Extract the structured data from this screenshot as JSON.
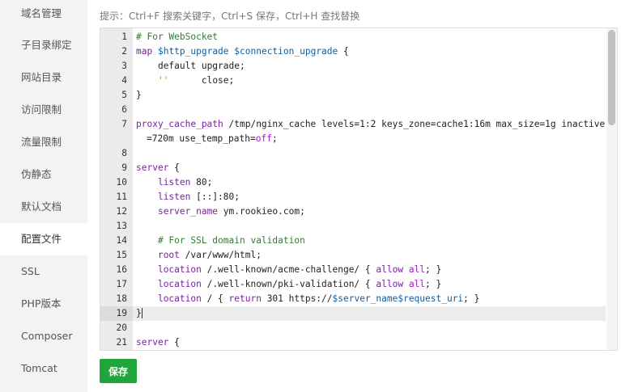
{
  "sidebar": {
    "items": [
      {
        "label": "域名管理"
      },
      {
        "label": "子目录绑定"
      },
      {
        "label": "网站目录"
      },
      {
        "label": "访问限制"
      },
      {
        "label": "流量限制"
      },
      {
        "label": "伪静态"
      },
      {
        "label": "默认文档"
      },
      {
        "label": "配置文件",
        "active": true
      },
      {
        "label": "SSL"
      },
      {
        "label": "PHP版本"
      },
      {
        "label": "Composer"
      },
      {
        "label": "Tomcat"
      }
    ]
  },
  "hint": "提示：Ctrl+F 搜索关键字，Ctrl+S 保存，Ctrl+H 查找替换",
  "editor": {
    "active_line": 19,
    "lines": [
      {
        "n": "1",
        "tokens": [
          [
            "c-comment",
            "# For WebSocket"
          ]
        ]
      },
      {
        "n": "2",
        "tokens": [
          [
            "c-kw",
            "map"
          ],
          [
            "",
            " "
          ],
          [
            "c-var",
            "$http_upgrade"
          ],
          [
            "",
            " "
          ],
          [
            "c-var",
            "$connection_upgrade"
          ],
          [
            "",
            " {"
          ]
        ]
      },
      {
        "n": "3",
        "tokens": [
          [
            "",
            "    default upgrade;"
          ]
        ]
      },
      {
        "n": "4",
        "tokens": [
          [
            "",
            "    "
          ],
          [
            "c-str",
            "''"
          ],
          [
            "",
            "      close;"
          ]
        ]
      },
      {
        "n": "5",
        "tokens": [
          [
            "",
            "}"
          ]
        ]
      },
      {
        "n": "6",
        "tokens": []
      },
      {
        "n": "7",
        "tokens": [
          [
            "c-kw",
            "proxy_cache_path"
          ],
          [
            "",
            " /tmp/nginx_cache levels=1:2 keys_zone=cache1:16m max_size=1g inactive"
          ]
        ],
        "cont": [
          [
            "",
            "=720m use_temp_path="
          ],
          [
            "c-bool",
            "off"
          ],
          [
            "",
            ";"
          ]
        ]
      },
      {
        "n": "8",
        "tokens": []
      },
      {
        "n": "9",
        "tokens": [
          [
            "c-kw",
            "server"
          ],
          [
            "",
            " {"
          ]
        ]
      },
      {
        "n": "10",
        "tokens": [
          [
            "",
            "    "
          ],
          [
            "c-kw",
            "listen"
          ],
          [
            "",
            " 80;"
          ]
        ]
      },
      {
        "n": "11",
        "tokens": [
          [
            "",
            "    "
          ],
          [
            "c-kw",
            "listen"
          ],
          [
            "",
            " [::]:80;"
          ]
        ]
      },
      {
        "n": "12",
        "tokens": [
          [
            "",
            "    "
          ],
          [
            "c-kw",
            "server_name"
          ],
          [
            "",
            " ym.rookieo.com;"
          ]
        ]
      },
      {
        "n": "13",
        "tokens": []
      },
      {
        "n": "14",
        "tokens": [
          [
            "",
            "    "
          ],
          [
            "c-comment",
            "# For SSL domain validation"
          ]
        ]
      },
      {
        "n": "15",
        "tokens": [
          [
            "",
            "    "
          ],
          [
            "c-kw",
            "root"
          ],
          [
            "",
            " /var/www/html;"
          ]
        ]
      },
      {
        "n": "16",
        "tokens": [
          [
            "",
            "    "
          ],
          [
            "c-kw",
            "location"
          ],
          [
            "",
            " /.well-known/acme-challenge/ { "
          ],
          [
            "c-kw",
            "allow"
          ],
          [
            "",
            " "
          ],
          [
            "c-bool",
            "all"
          ],
          [
            "",
            "; }"
          ]
        ]
      },
      {
        "n": "17",
        "tokens": [
          [
            "",
            "    "
          ],
          [
            "c-kw",
            "location"
          ],
          [
            "",
            " /.well-known/pki-validation/ { "
          ],
          [
            "c-kw",
            "allow"
          ],
          [
            "",
            " "
          ],
          [
            "c-bool",
            "all"
          ],
          [
            "",
            "; }"
          ]
        ]
      },
      {
        "n": "18",
        "tokens": [
          [
            "",
            "    "
          ],
          [
            "c-kw",
            "location"
          ],
          [
            "",
            " / { "
          ],
          [
            "c-kw",
            "return"
          ],
          [
            "",
            " 301 https://"
          ],
          [
            "c-var",
            "$server_name"
          ],
          [
            "c-var",
            "$request_uri"
          ],
          [
            "",
            "; }"
          ]
        ]
      },
      {
        "n": "19",
        "tokens": [
          [
            "",
            "}"
          ]
        ]
      },
      {
        "n": "20",
        "tokens": []
      },
      {
        "n": "21",
        "tokens": [
          [
            "c-kw",
            "server"
          ],
          [
            "",
            " {"
          ]
        ]
      }
    ]
  },
  "save_button": {
    "label": "保存",
    "color": "#20a53a"
  }
}
